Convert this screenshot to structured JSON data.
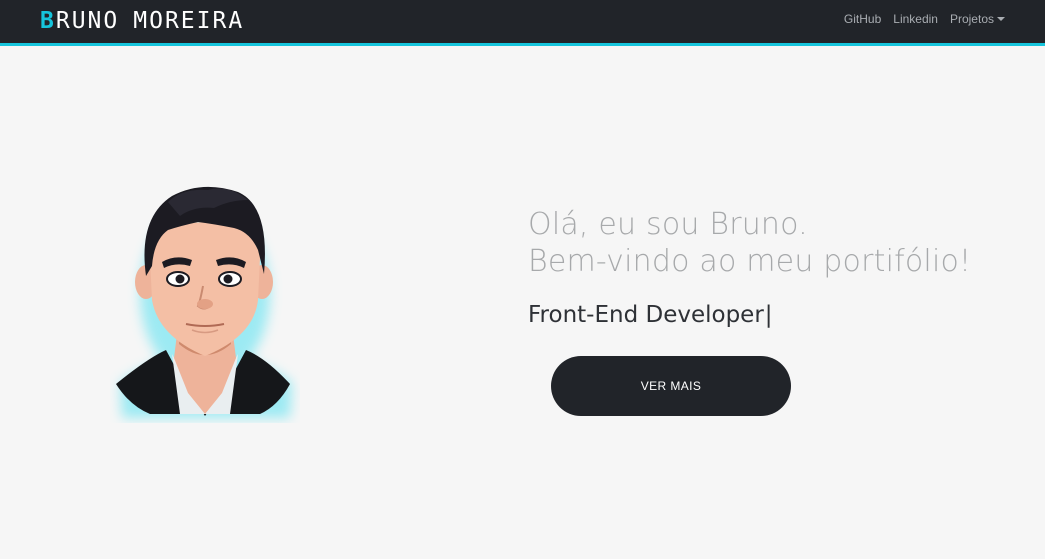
{
  "header": {
    "brand_initial": "B",
    "brand_first": "RUNO",
    "brand_last": "MOREIRA",
    "nav": [
      {
        "label": "GitHub"
      },
      {
        "label": "Linkedin"
      },
      {
        "label": "Projetos"
      }
    ]
  },
  "hero": {
    "greeting_line1": "Olá, eu sou Bruno.",
    "greeting_line2": "Bem-vindo ao meu portifólio!",
    "role": "Front-End Developer",
    "cursor": "|",
    "cta_label": "VER MAIS"
  },
  "colors": {
    "accent": "#16c5dc",
    "navbar": "#212429",
    "background": "#f6f6f6",
    "button": "#212429"
  }
}
